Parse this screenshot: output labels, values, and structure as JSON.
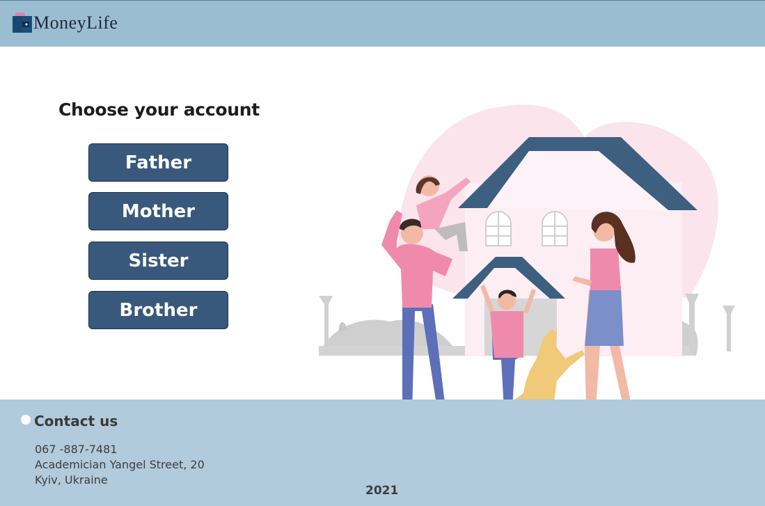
{
  "header": {
    "brand": "MoneyLife",
    "logo_icon": "wallet-icon",
    "background": "#9bbdd2"
  },
  "main": {
    "title": "Choose your account",
    "accounts": [
      {
        "label": "Father"
      },
      {
        "label": "Mother"
      },
      {
        "label": "Sister"
      },
      {
        "label": "Brother"
      }
    ],
    "button_color": "#38597c",
    "illustration": "family-house-illustration"
  },
  "footer": {
    "contact_title": "Contact us",
    "phone": "067 -887-7481",
    "address": "Academician Yangel Street, 20",
    "city": "Kyiv, Ukraine",
    "year": "2021",
    "background": "#b1cbdc"
  }
}
